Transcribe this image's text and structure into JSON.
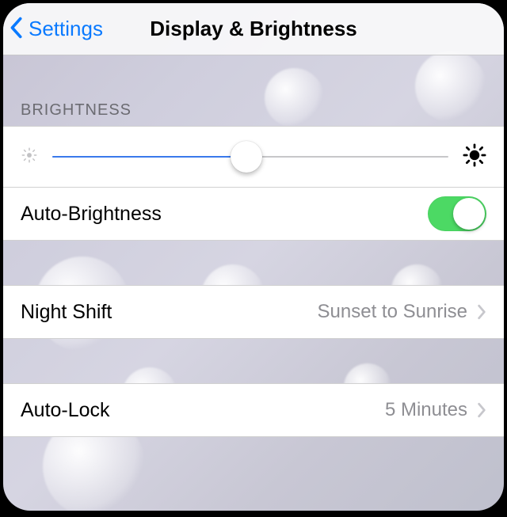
{
  "nav": {
    "back_label": "Settings",
    "title": "Display & Brightness"
  },
  "sections": {
    "brightness_header": "BRIGHTNESS",
    "slider_percent": 49,
    "auto_brightness_label": "Auto-Brightness",
    "auto_brightness_on": true,
    "night_shift_label": "Night Shift",
    "night_shift_value": "Sunset to Sunrise",
    "auto_lock_label": "Auto-Lock",
    "auto_lock_value": "5 Minutes"
  }
}
